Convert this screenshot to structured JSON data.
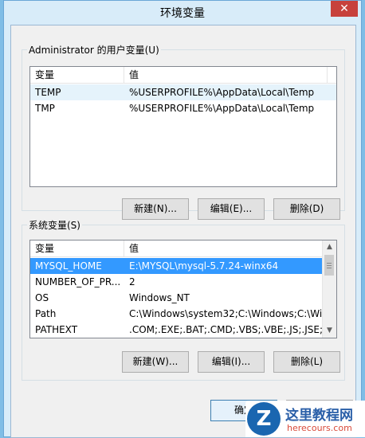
{
  "window": {
    "title": "环境变量",
    "close_glyph": "✕"
  },
  "user_vars": {
    "group_label": "Administrator 的用户变量(U)",
    "columns": [
      "变量",
      "值"
    ],
    "rows": [
      {
        "name": "TEMP",
        "value": "%USERPROFILE%\\AppData\\Local\\Temp"
      },
      {
        "name": "TMP",
        "value": "%USERPROFILE%\\AppData\\Local\\Temp"
      }
    ],
    "buttons": {
      "new": "新建(N)...",
      "edit": "编辑(E)...",
      "delete": "删除(D)"
    }
  },
  "system_vars": {
    "group_label": "系统变量(S)",
    "columns": [
      "变量",
      "值"
    ],
    "rows": [
      {
        "name": "MYSQL_HOME",
        "value": "E:\\MYSQL\\mysql-5.7.24-winx64"
      },
      {
        "name": "NUMBER_OF_PR...",
        "value": "2"
      },
      {
        "name": "OS",
        "value": "Windows_NT"
      },
      {
        "name": "Path",
        "value": "C:\\Windows\\system32;C:\\Windows;C:\\Wi..."
      },
      {
        "name": "PATHEXT",
        "value": ".COM;.EXE;.BAT;.CMD;.VBS;.VBE;.JS;.JSE;..."
      }
    ],
    "selected_row": 0,
    "buttons": {
      "new": "新建(W)...",
      "edit": "编辑(I)...",
      "delete": "删除(L)"
    }
  },
  "footer": {
    "ok": "确定"
  },
  "watermark": {
    "logo_letter": "Z",
    "text": "这里教程网",
    "sub": "herecours.com"
  },
  "colors": {
    "selection": "#3399ff",
    "window_frame": "#d8ecf9",
    "close": "#c7413c"
  }
}
